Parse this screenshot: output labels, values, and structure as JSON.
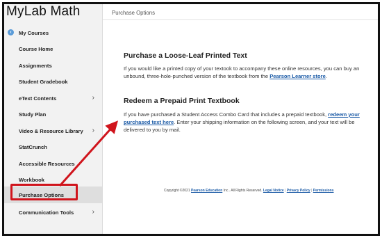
{
  "app": {
    "logo": "MyLab Math"
  },
  "sidebar": {
    "items": [
      {
        "label": "My Courses",
        "icon": "back-arrow-icon"
      },
      {
        "label": "Course Home"
      },
      {
        "label": "Assignments"
      },
      {
        "label": "Student Gradebook"
      },
      {
        "label": "eText Contents",
        "chevron": "›"
      },
      {
        "label": "Study Plan"
      },
      {
        "label": "Video & Resource Library",
        "chevron": "›"
      },
      {
        "label": "StatCrunch"
      },
      {
        "label": "Accessible Resources"
      },
      {
        "label": "Workbook"
      },
      {
        "label": "Purchase Options",
        "active": true
      },
      {
        "label": "Communication Tools",
        "chevron": "›"
      }
    ]
  },
  "header": {
    "breadcrumb": "Purchase Options"
  },
  "sections": {
    "loose_leaf": {
      "title": "Purchase a Loose-Leaf Printed Text",
      "text_before": "If you would like a printed copy of your textook to accompany these online resources, you can buy an unbound, three-hole-punched version of the textbook from the ",
      "link": "Pearson Learner store",
      "text_after": "."
    },
    "redeem": {
      "title": "Redeem a Prepaid Print Textbook",
      "text_before": "If you have purchased a Student Access Combo Card that includes a prepaid textbook, ",
      "link": "redeem your purchased text here",
      "text_after": ". Enter your shipping information on the following screen, and your text will be delivered to you by mail."
    }
  },
  "footer": {
    "copyright": "Copyright ©2021 ",
    "company_link": "Pearson Education",
    "rights": " Inc.. All Rights Reserved. ",
    "legal": "Legal Notice",
    "privacy": "Privacy Policy",
    "permissions": "Permissions",
    "sep": " | "
  },
  "colors": {
    "link": "#1a5aa6",
    "highlight": "#d0141c",
    "sidebar_bg": "#f2f2f2"
  }
}
